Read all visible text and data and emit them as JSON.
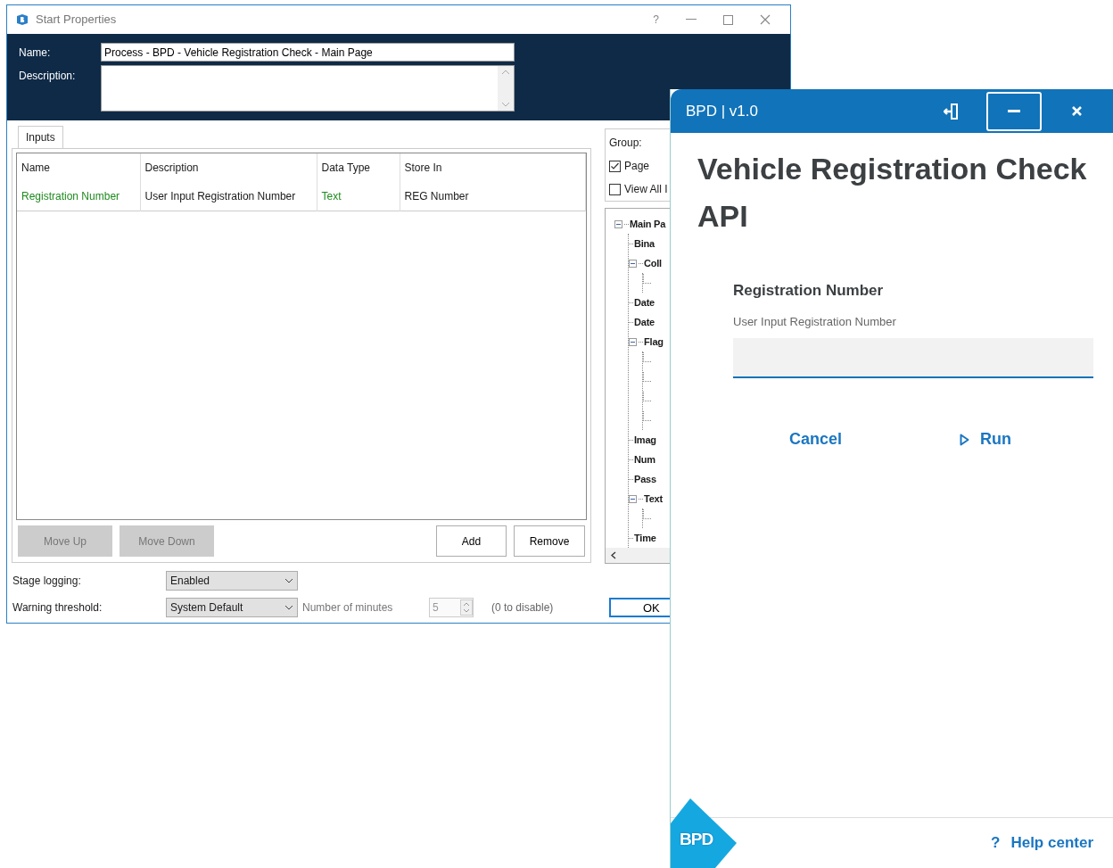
{
  "dialog": {
    "title": "Start Properties",
    "help": "?",
    "name_label": "Name:",
    "name_value": "Process - BPD - Vehicle Registration Check - Main Page",
    "description_label": "Description:",
    "tabs": [
      {
        "label": "Inputs",
        "selected": true
      }
    ],
    "table": {
      "columns": [
        "Name",
        "Description",
        "Data Type",
        "Store In"
      ],
      "rows": [
        {
          "cells": [
            {
              "text": "Registration Number",
              "color": "#1f8a1f"
            },
            {
              "text": "User Input Registration Number",
              "color": "#1a1a1a"
            },
            {
              "text": "Text",
              "color": "#1f8a1f"
            },
            {
              "text": "REG Number",
              "color": "#1a1a1a"
            }
          ]
        }
      ]
    },
    "buttons": [
      {
        "label": "Move Up",
        "disabled": true,
        "kind": "left"
      },
      {
        "label": "Move Down",
        "disabled": true,
        "kind": "left"
      },
      {
        "label": "Add",
        "disabled": false,
        "kind": "right"
      },
      {
        "label": "Remove",
        "disabled": false,
        "kind": "right"
      }
    ],
    "group": {
      "label": "Group:",
      "options": [
        {
          "label": "Page",
          "checked": true
        },
        {
          "label": "View All I",
          "checked": false
        }
      ]
    },
    "tree": [
      {
        "label": "Main Pa",
        "expanded": true,
        "children": [
          {
            "label": "Bina"
          },
          {
            "label": "Coll",
            "expanded": true,
            "children": [
              {
                "kind": "hidden"
              }
            ]
          },
          {
            "label": "Date"
          },
          {
            "label": "Date"
          },
          {
            "label": "Flag",
            "expanded": true,
            "children": [
              {
                "kind": "hidden"
              },
              {
                "kind": "hidden"
              },
              {
                "kind": "hidden"
              },
              {
                "kind": "hidden"
              }
            ]
          },
          {
            "label": "Imag"
          },
          {
            "label": "Num"
          },
          {
            "label": "Pass"
          },
          {
            "label": "Text",
            "expanded": true,
            "children": [
              {
                "kind": "hidden"
              }
            ]
          },
          {
            "label": "Time"
          }
        ]
      }
    ],
    "stage_logging": {
      "label": "Stage logging:",
      "value": "Enabled"
    },
    "warning_threshold": {
      "label": "Warning threshold:",
      "value": "System Default"
    },
    "minutes": {
      "label": "Number of minutes",
      "value": "5",
      "disabled": true,
      "hint": "(0 to disable)"
    },
    "ok": "OK"
  },
  "panel": {
    "title": "BPD | v1.0",
    "heading": "Vehicle Registration Check API",
    "field": {
      "label": "Registration Number",
      "description": "User Input Registration Number"
    },
    "actions": [
      {
        "label": "Cancel",
        "kind": "cancel"
      },
      {
        "label": "Run",
        "kind": "run"
      }
    ],
    "logo": "BPD",
    "help": {
      "mark": "?",
      "label": "Help center"
    }
  }
}
